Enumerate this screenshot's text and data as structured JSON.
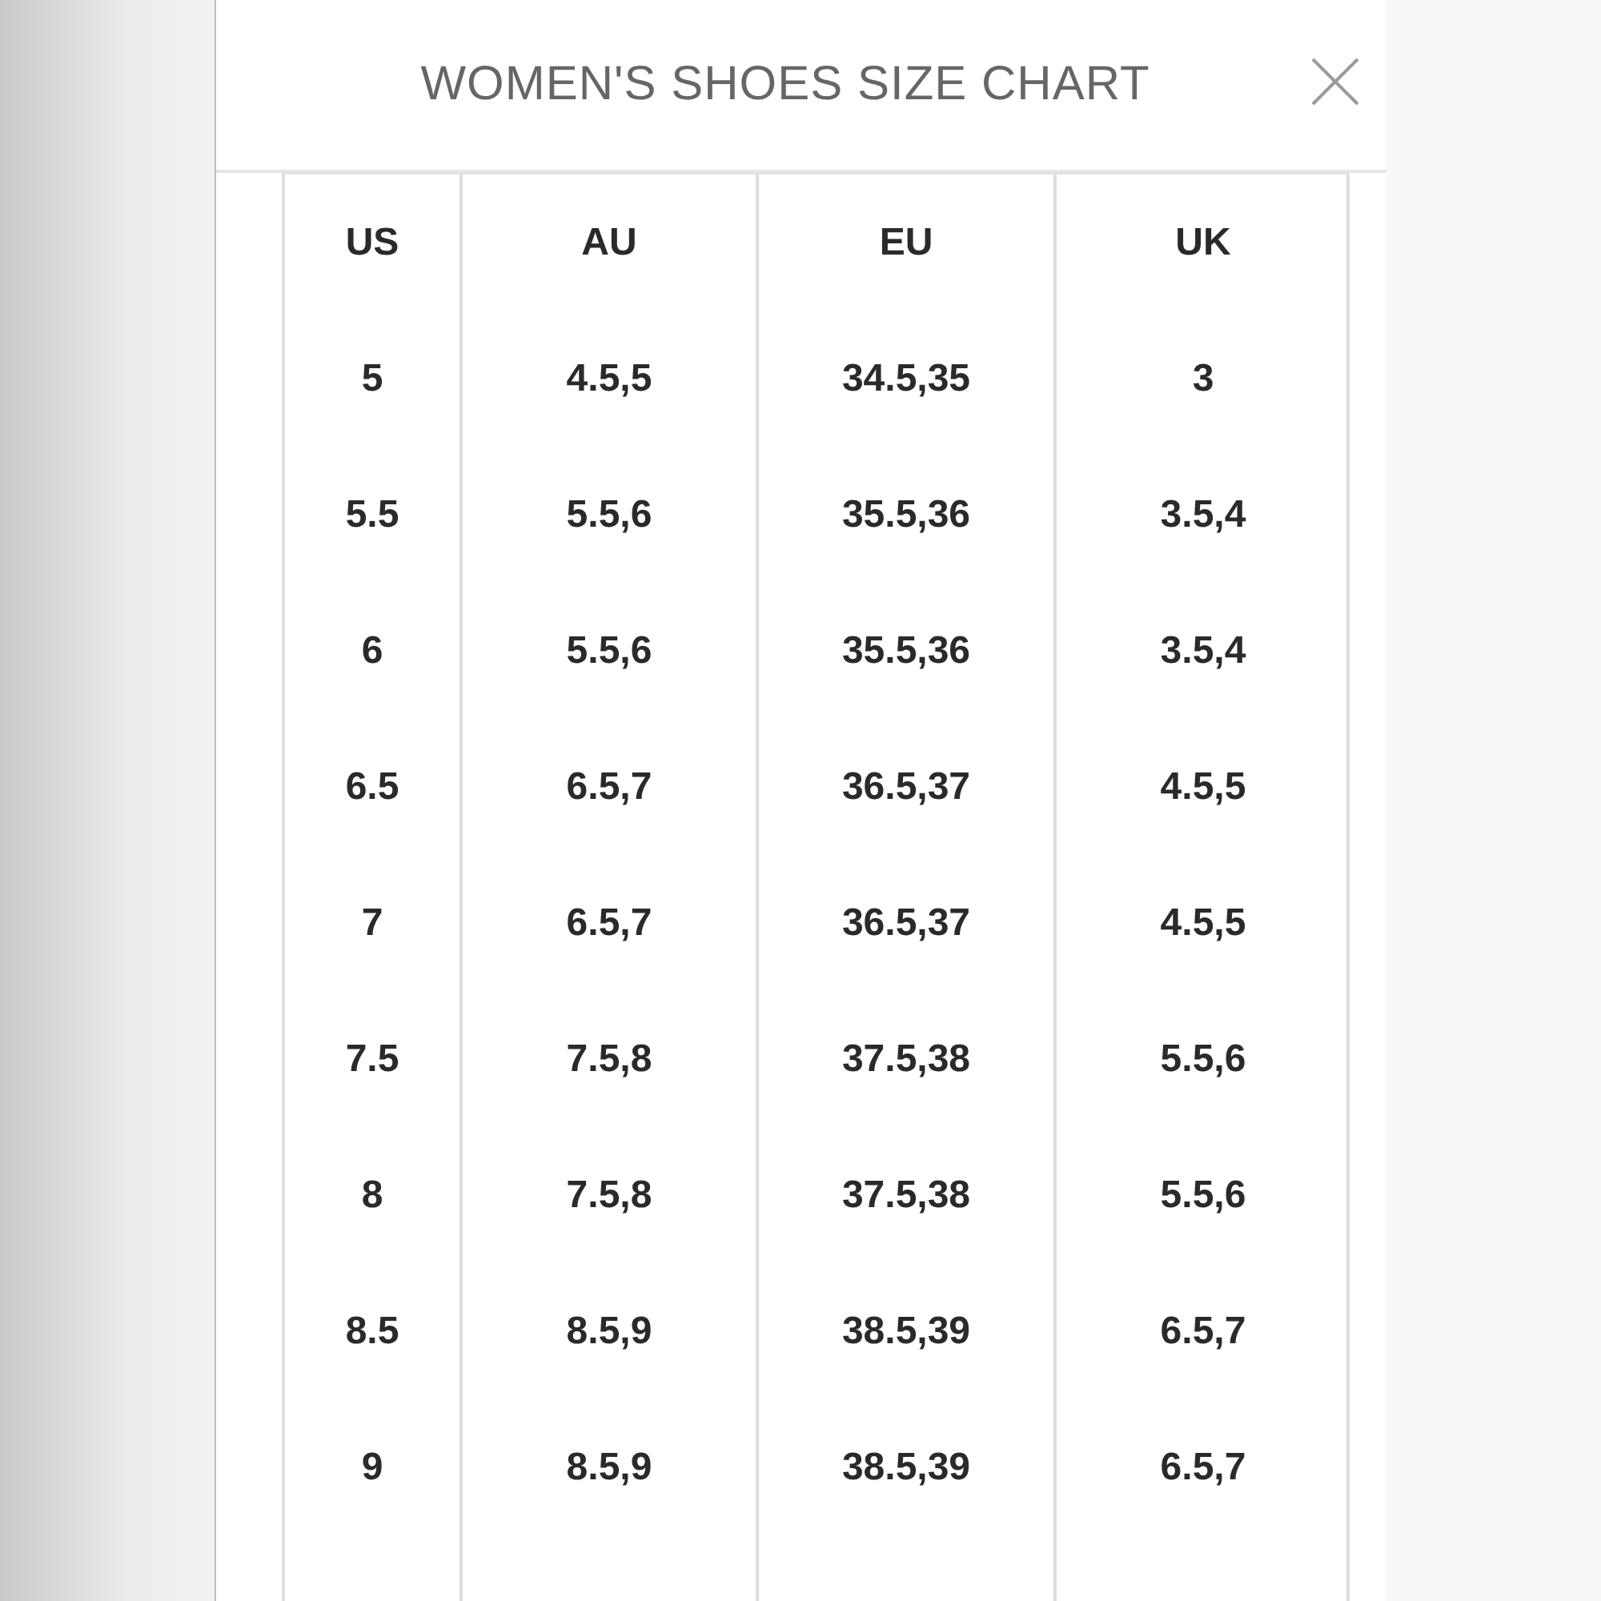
{
  "dialog": {
    "title": "WOMEN'S SHOES SIZE CHART"
  },
  "table": {
    "columns": [
      "US",
      "AU",
      "EU",
      "UK"
    ],
    "rows": [
      [
        "5",
        "4.5,5",
        "34.5,35",
        "3"
      ],
      [
        "5.5",
        "5.5,6",
        "35.5,36",
        "3.5,4"
      ],
      [
        "6",
        "5.5,6",
        "35.5,36",
        "3.5,4"
      ],
      [
        "6.5",
        "6.5,7",
        "36.5,37",
        "4.5,5"
      ],
      [
        "7",
        "6.5,7",
        "36.5,37",
        "4.5,5"
      ],
      [
        "7.5",
        "7.5,8",
        "37.5,38",
        "5.5,6"
      ],
      [
        "8",
        "7.5,8",
        "37.5,38",
        "5.5,6"
      ],
      [
        "8.5",
        "8.5,9",
        "38.5,39",
        "6.5,7"
      ],
      [
        "9",
        "8.5,9",
        "38.5,39",
        "6.5,7"
      ]
    ]
  }
}
